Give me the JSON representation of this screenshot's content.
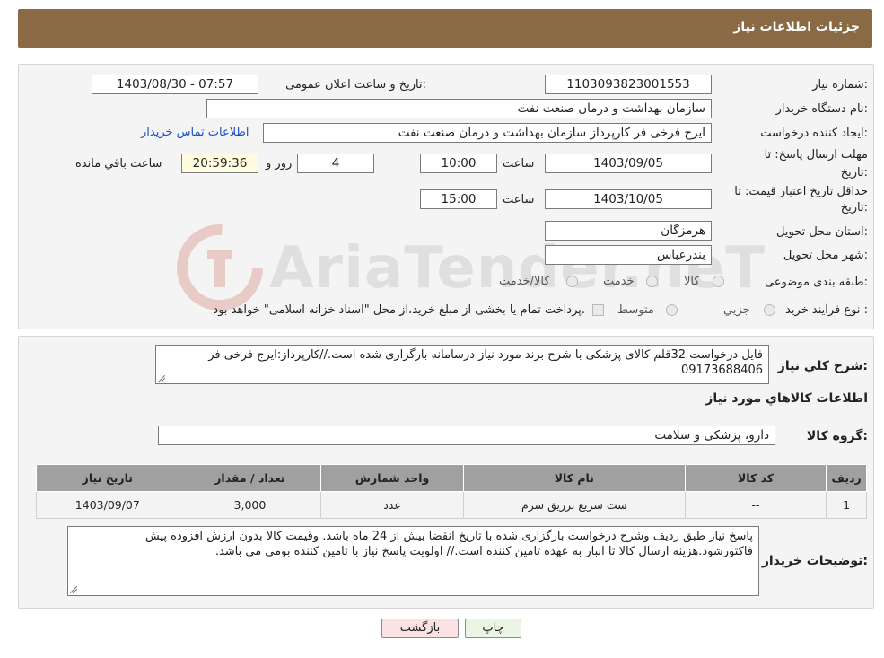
{
  "header": {
    "title": "جزئیات اطلاعات نیاز"
  },
  "form": {
    "need_number_label": "شماره نیاز:",
    "need_number": "1103093823001553",
    "announce_label": "تاریخ و ساعت اعلان عمومی:",
    "announce_value": "1403/08/30 - 07:57",
    "buyer_org_label": "نام دستگاه خریدار:",
    "buyer_org": "سازمان بهداشت و درمان صنعت نفت",
    "creator_label": "ایجاد کننده درخواست:",
    "creator": "ایرج فرخی فر کارپرداز  سازمان بهداشت و درمان صنعت نفت",
    "contact_link": "اطلاعات تماس خریدار",
    "deadline_label_1": "مهلت ارسال پاسخ: تا",
    "deadline_label_2": "تاریخ:",
    "deadline_date": "1403/09/05",
    "time_label": "ساعت",
    "deadline_time": "10:00",
    "days_value": "4",
    "days_label": "روز و",
    "remaining_value": "20:59:36",
    "remaining_label": "ساعت باقي مانده",
    "validity_label_1": "حداقل تاریخ اعتبار قیمت: تا",
    "validity_label_2": "تاریخ:",
    "validity_date": "1403/10/05",
    "validity_time": "15:00",
    "province_label": "استان محل تحویل:",
    "province": "هرمزگان",
    "city_label": "شهر محل تحویل:",
    "city": "بندرعباس",
    "category_label": "طبقه بندی موضوعی:",
    "category_options": [
      "کالا",
      "خدمت",
      "کالا/خدمت"
    ],
    "purchase_type_label": "نوع فرآیند خرید :",
    "purchase_options": [
      "جزیي",
      "متوسط"
    ],
    "purchase_note": "پرداخت تمام یا بخشی از مبلغ خرید،از محل \"اسناد خزانه اسلامی\" خواهد بود."
  },
  "details": {
    "description_label": "شرح کلي نياز:",
    "description": "فایل درخواست 32قلم کالای پزشکی با شرح برند مورد نیاز درسامانه بارگزاری شده است.//کارپرداز:ایرج فرخی فر 09173688406",
    "items_heading": "اطلاعات کالاهاي مورد نياز",
    "group_label": "گروه کالا:",
    "group_value": "دارو، پزشکی و سلامت",
    "table": {
      "headers": [
        "رديف",
        "کد کالا",
        "نام کالا",
        "واحد شمارش",
        "تعداد / مقدار",
        "تاريخ نياز"
      ],
      "rows": [
        [
          "1",
          "--",
          "ست سریع تزریق سرم",
          "عدد",
          "3,000",
          "1403/09/07"
        ]
      ]
    },
    "buyer_notes_label": "توضیحات خریدار:",
    "buyer_notes": "پاسخ نیاز طبق ردیف وشرح درخواست بارگزاری شده با تاریخ انقضا بیش از 24 ماه باشد. وقیمت کالا بدون ارزش افزوده پیش فاکتورشود.هزینه ارسال کالا تا انبار به عهده تامین کننده است.// اولویت پاسخ نیاز با تامین کننده بومی می باشد."
  },
  "buttons": {
    "print": "چاپ",
    "back": "بازگشت"
  },
  "watermark": {
    "text": "AriaTender.neT"
  }
}
